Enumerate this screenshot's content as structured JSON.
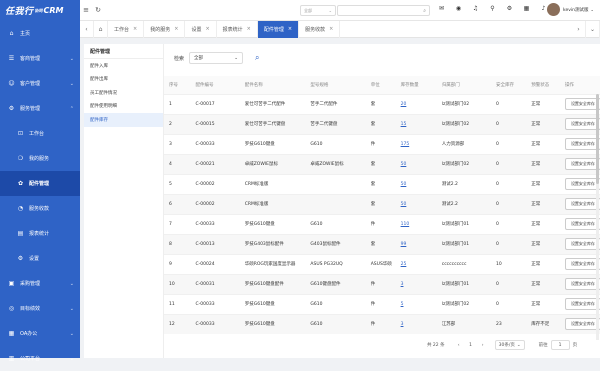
{
  "logo": {
    "main": "任我行",
    "sub": "协同",
    "crm": "CRM"
  },
  "sidebar": {
    "items": [
      {
        "label": "主页",
        "icon": "home-icon",
        "glyph": "⌂",
        "chev": "",
        "sub": false
      },
      {
        "label": "客商管理",
        "icon": "merchant-icon",
        "glyph": "☰",
        "chev": "⌄",
        "sub": false
      },
      {
        "label": "客户管理",
        "icon": "customer-icon",
        "glyph": "☺",
        "chev": "⌄",
        "sub": false
      },
      {
        "label": "服务管理",
        "icon": "service-icon",
        "glyph": "⚙",
        "chev": "⌃",
        "sub": false
      },
      {
        "label": "工作台",
        "icon": "workbench-icon",
        "glyph": "⊡",
        "chev": "",
        "sub": true
      },
      {
        "label": "我的服务",
        "icon": "myservice-icon",
        "glyph": "❍",
        "chev": "",
        "sub": true
      },
      {
        "label": "配件管理",
        "icon": "parts-icon",
        "glyph": "✿",
        "chev": "",
        "sub": true,
        "active": true
      },
      {
        "label": "服务收款",
        "icon": "payment-icon",
        "glyph": "◔",
        "chev": "",
        "sub": true
      },
      {
        "label": "报表统计",
        "icon": "report-icon",
        "glyph": "▤",
        "chev": "",
        "sub": true
      },
      {
        "label": "设置",
        "icon": "settings-icon",
        "glyph": "⚙",
        "chev": "",
        "sub": true
      },
      {
        "label": "采购管理",
        "icon": "purchase-icon",
        "glyph": "▣",
        "chev": "⌄",
        "sub": false
      },
      {
        "label": "目标绩效",
        "icon": "target-icon",
        "glyph": "◎",
        "chev": "⌄",
        "sub": false
      },
      {
        "label": "OA办公",
        "icon": "oa-icon",
        "glyph": "▦",
        "chev": "⌄",
        "sub": false
      },
      {
        "label": "公司平台",
        "icon": "company-icon",
        "glyph": "▥",
        "chev": "⌄",
        "sub": false
      }
    ]
  },
  "topbar": {
    "scope": "全部",
    "user_name": "kevin测试版"
  },
  "tabs": [
    {
      "label": "工作台",
      "active": false
    },
    {
      "label": "我的服务",
      "active": false
    },
    {
      "label": "设置",
      "active": false
    },
    {
      "label": "报表统计",
      "active": false
    },
    {
      "label": "配件管理",
      "active": true
    },
    {
      "label": "服务收款",
      "active": false
    }
  ],
  "leftpanel": {
    "title": "配件管理",
    "items": [
      {
        "label": "配件入库",
        "active": false
      },
      {
        "label": "配件出库",
        "active": false
      },
      {
        "label": "员工配件情况",
        "active": false
      },
      {
        "label": "配件使用明细",
        "active": false
      },
      {
        "label": "配件库存",
        "active": true
      }
    ]
  },
  "filter": {
    "label": "检索",
    "value": "全部"
  },
  "table": {
    "headers": [
      "序号",
      "配件编号",
      "配件名称",
      "型号规格",
      "单位",
      "库存数量",
      "归属部门",
      "安全库存",
      "预警状态",
      "操作"
    ],
    "action_label": "设置安全库存",
    "rows": [
      [
        "1",
        "C-00017",
        "爱仕可苦手二代配件",
        "苦手二代配件",
        "套",
        "20",
        "lz测试部门02",
        "0",
        "正常"
      ],
      [
        "2",
        "C-00015",
        "爱仕可苦手二代键盘",
        "苦手二代键盘",
        "套",
        "15",
        "lz测试部门02",
        "0",
        "正常"
      ],
      [
        "3",
        "C-00033",
        "罗技G610键盘",
        "G610",
        "件",
        "175",
        "人力资源部",
        "0",
        "正常"
      ],
      [
        "4",
        "C-00021",
        "卓威ZOWIE鼠标",
        "卓威ZOWIE鼠标",
        "套",
        "50",
        "lz测试部门02",
        "0",
        "正常"
      ],
      [
        "5",
        "C-00002",
        "CRM标准版",
        "",
        "套",
        "50",
        "测试2.2",
        "0",
        "正常"
      ],
      [
        "6",
        "C-00002",
        "CRM标准版",
        "",
        "套",
        "50",
        "测试2.2",
        "0",
        "正常"
      ],
      [
        "7",
        "C-00033",
        "罗技G610键盘",
        "G610",
        "件",
        "110",
        "lz测试部门01",
        "0",
        "正常"
      ],
      [
        "8",
        "C-00013",
        "罗技G403鼠标配件",
        "G403鼠标配件",
        "套",
        "99",
        "lz测试部门01",
        "0",
        "正常"
      ],
      [
        "9",
        "C-00024",
        "华硕ROG玩家国度显示器",
        "ASUS PG32UQ",
        "ASUS华硕",
        "25",
        "cccccccccc",
        "10",
        "正常"
      ],
      [
        "10",
        "C-00031",
        "罗技G610键盘配件",
        "G610键盘配件",
        "件",
        "3",
        "lz测试部门01",
        "0",
        "正常"
      ],
      [
        "11",
        "C-00033",
        "罗技G610键盘",
        "G610",
        "件",
        "5",
        "lz测试部门02",
        "0",
        "正常"
      ],
      [
        "12",
        "C-00033",
        "罗技G610键盘",
        "G610",
        "件",
        "3",
        "江苏部",
        "23",
        "库存不足"
      ]
    ]
  },
  "pager": {
    "total": "共 22 条",
    "prev": "‹",
    "page": "1",
    "next": "›",
    "per_page": "30条/页",
    "goto_label": "前往",
    "goto_value": "1",
    "unit": "页"
  }
}
